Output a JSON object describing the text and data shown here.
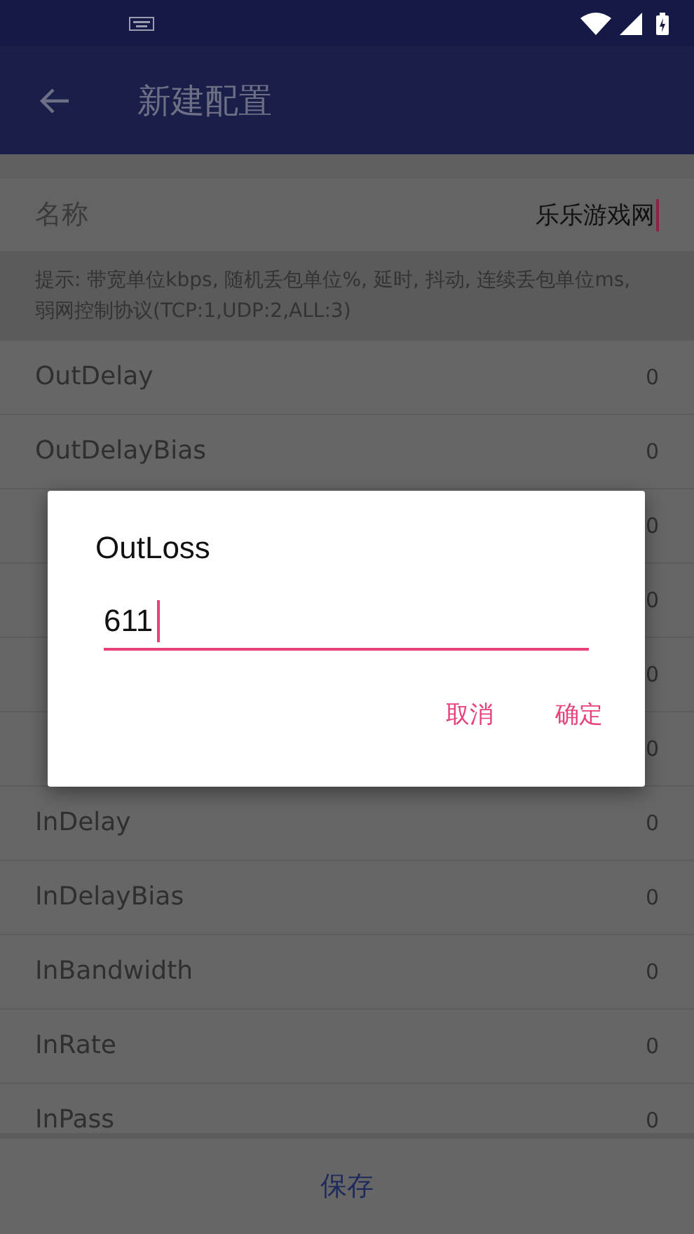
{
  "app_bar": {
    "title": "新建配置"
  },
  "name_field": {
    "label": "名称",
    "value": "乐乐游戏网"
  },
  "hint": "提示: 带宽单位kbps, 随机丢包单位%, 延时, 抖动, 连续丢包单位ms, 弱网控制协议(TCP:1,UDP:2,ALL:3)",
  "rows": [
    {
      "label": "OutDelay",
      "value": "0"
    },
    {
      "label": "OutDelayBias",
      "value": "0"
    },
    {
      "value": "0"
    },
    {
      "value": "0"
    },
    {
      "value": "0"
    },
    {
      "value": "0"
    },
    {
      "label": "InDelay",
      "value": "0"
    },
    {
      "label": "InDelayBias",
      "value": "0"
    },
    {
      "label": "InBandwidth",
      "value": "0"
    },
    {
      "label": "InRate",
      "value": "0"
    },
    {
      "label": "InPass",
      "value": "0"
    }
  ],
  "save_button": "保存",
  "dialog": {
    "title": "OutLoss",
    "value": "611",
    "buttons": [
      "取消",
      "确定"
    ]
  }
}
